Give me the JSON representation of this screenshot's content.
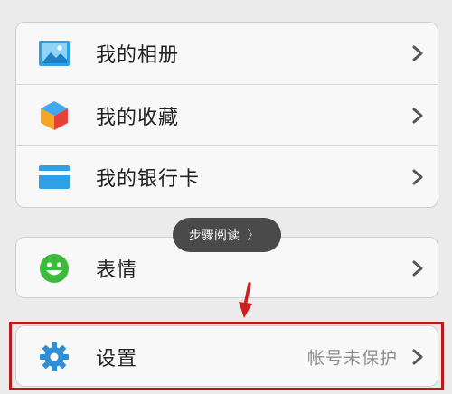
{
  "menu_group_1": {
    "items": [
      {
        "label": "我的相册",
        "icon": "photo-album-icon",
        "icon_color": "#2fa0e4"
      },
      {
        "label": "我的收藏",
        "icon": "collection-cube-icon",
        "icon_color": "#f5a623"
      },
      {
        "label": "我的银行卡",
        "icon": "bank-card-icon",
        "icon_color": "#2fa0e4"
      }
    ]
  },
  "menu_group_2": {
    "items": [
      {
        "label": "表情",
        "icon": "emoji-face-icon",
        "icon_color": "#3cba3c"
      }
    ]
  },
  "menu_group_3": {
    "items": [
      {
        "label": "设置",
        "value": "帐号未保护",
        "icon": "settings-gear-icon",
        "icon_color": "#2f8fd6"
      }
    ]
  },
  "tooltip": {
    "text": "步骤阅读",
    "arrow": "〉"
  },
  "annotation": {
    "highlight_color": "#b51c1c"
  }
}
